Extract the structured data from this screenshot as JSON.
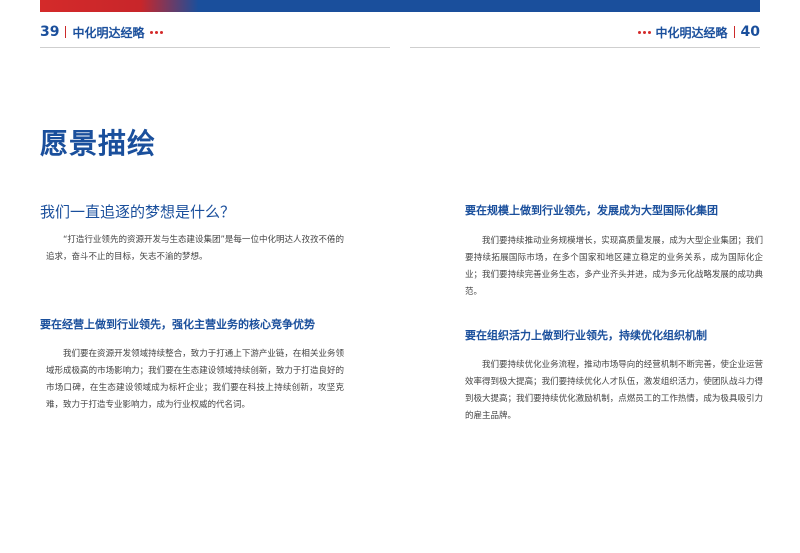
{
  "header": {
    "left_page": "39",
    "right_page": "40",
    "brand": "中化明达经略"
  },
  "title": "愿景描绘",
  "question": "我们一直追逐的梦想是什么？",
  "intro": "“打造行业领先的资源开发与生态建设集团”是每一位中化明达人孜孜不倦的追求，奋斗不止的目标，矢志不渝的梦想。",
  "sections": [
    {
      "heading": "要在经营上做到行业领先，强化主营业务的核心竞争优势",
      "body": "我们要在资源开发领域持续整合，致力于打通上下游产业链，在相关业务领域形成极高的市场影响力；我们要在生态建设领域持续创新，致力于打造良好的市场口碑，在生态建设领域成为标杆企业；我们要在科技上持续创新，攻坚克难，致力于打造专业影响力，成为行业权威的代名词。"
    },
    {
      "heading": "要在规模上做到行业领先，发展成为大型国际化集团",
      "body": "我们要持续推动业务规模增长，实现高质量发展，成为大型企业集团；我们要持续拓展国际市场，在多个国家和地区建立稳定的业务关系，成为国际化企业；我们要持续完善业务生态，多产业齐头并进，成为多元化战略发展的成功典范。"
    },
    {
      "heading": "要在组织活力上做到行业领先，持续优化组织机制",
      "body": "我们要持续优化业务流程，推动市场导向的经营机制不断完善，使企业运营效率得到极大提高；我们要持续优化人才队伍，激发组织活力，使团队战斗力得到极大提高；我们要持续优化激励机制，点燃员工的工作热情，成为极具吸引力的雇主品牌。"
    }
  ]
}
